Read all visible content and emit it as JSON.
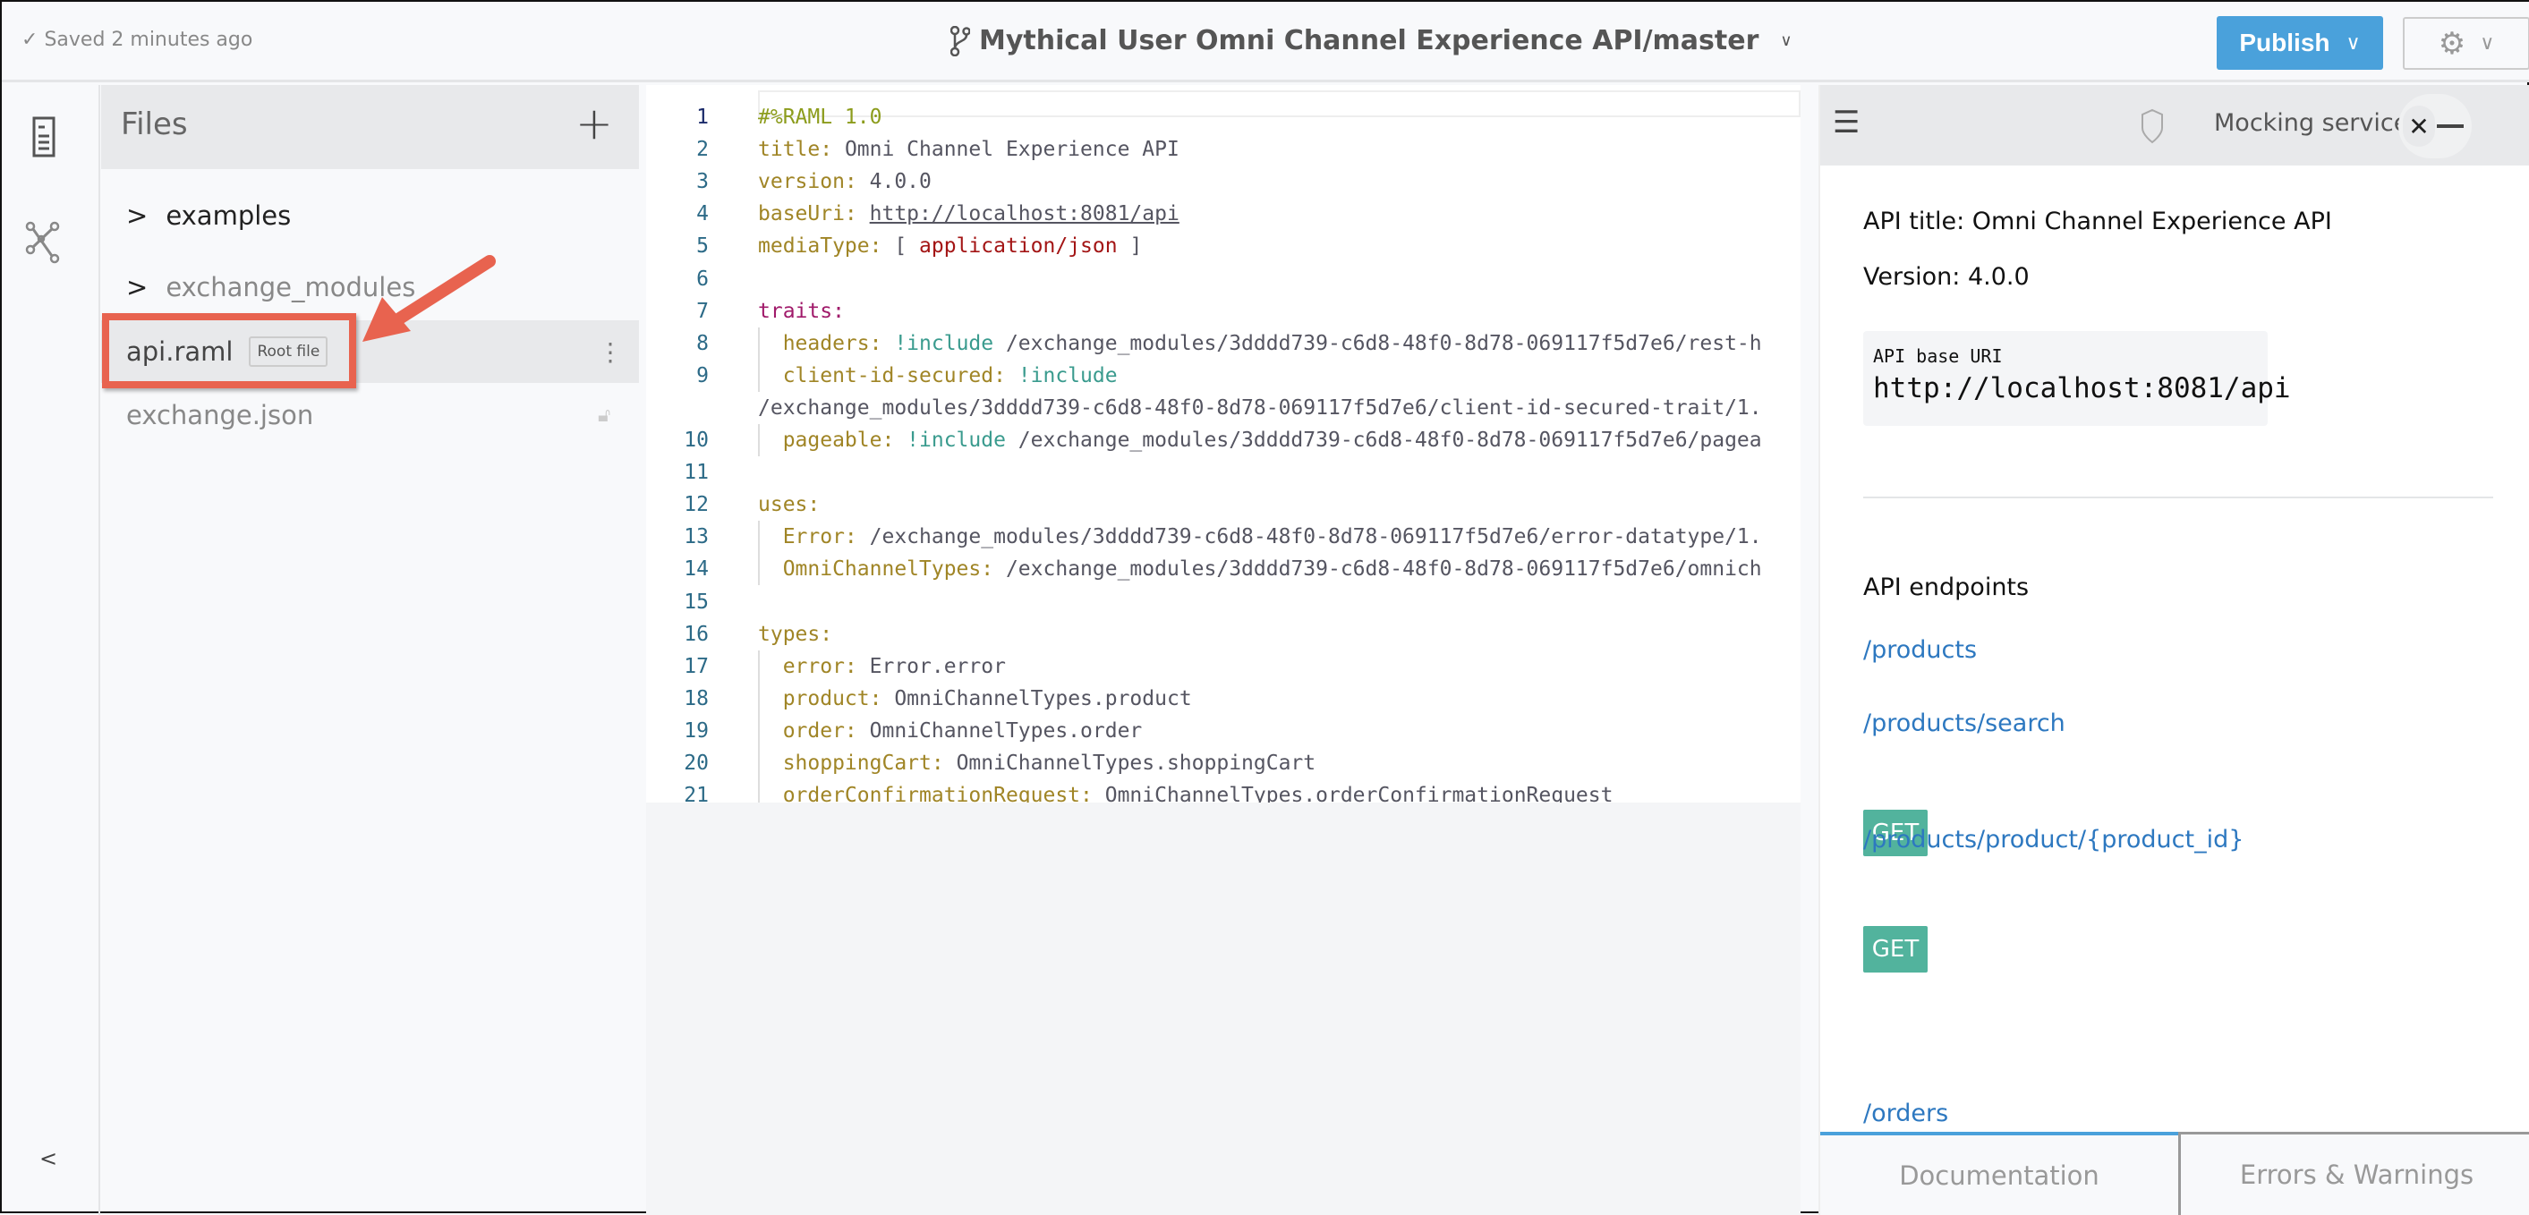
{
  "header": {
    "saved": "Saved 2 minutes ago",
    "project_title": "Mythical User Omni Channel Experience API/master",
    "publish_label": "Publish"
  },
  "files": {
    "title": "Files",
    "items": [
      {
        "name": "examples",
        "type": "folder"
      },
      {
        "name": "exchange_modules",
        "type": "folder"
      },
      {
        "name": "api.raml",
        "badge": "Root file",
        "selected": true
      },
      {
        "name": "exchange.json",
        "locked": true
      }
    ]
  },
  "editor": {
    "lines": [
      {
        "n": "1",
        "seg": [
          [
            "h",
            "#%RAML 1.0"
          ]
        ]
      },
      {
        "n": "2",
        "seg": [
          [
            "k",
            "title: "
          ],
          [
            "s",
            "Omni Channel Experience API"
          ]
        ]
      },
      {
        "n": "3",
        "seg": [
          [
            "k",
            "version: "
          ],
          [
            "s",
            "4.0.0"
          ]
        ]
      },
      {
        "n": "4",
        "seg": [
          [
            "k",
            "baseUri: "
          ],
          [
            "s u",
            "http://localhost:8081/api"
          ]
        ]
      },
      {
        "n": "5",
        "seg": [
          [
            "k",
            "mediaType: "
          ],
          [
            "s",
            "[ "
          ],
          [
            "r",
            "application/json"
          ],
          [
            "s",
            " ]"
          ]
        ]
      },
      {
        "n": "6",
        "seg": []
      },
      {
        "n": "7",
        "seg": [
          [
            "t",
            "traits:"
          ]
        ]
      },
      {
        "n": "8",
        "seg": [
          [
            "k",
            "  headers: "
          ],
          [
            "i",
            "!include "
          ],
          [
            "s",
            "/exchange_modules/3dddd739-c6d8-48f0-8d78-069117f5d7e6/rest-h"
          ]
        ]
      },
      {
        "n": "9",
        "seg": [
          [
            "k",
            "  client-id-secured: "
          ],
          [
            "i",
            "!include"
          ]
        ]
      },
      {
        "n": "",
        "seg": [
          [
            "s",
            "/exchange_modules/3dddd739-c6d8-48f0-8d78-069117f5d7e6/client-id-secured-trait/1."
          ]
        ]
      },
      {
        "n": "10",
        "seg": [
          [
            "k",
            "  pageable: "
          ],
          [
            "i",
            "!include "
          ],
          [
            "s",
            "/exchange_modules/3dddd739-c6d8-48f0-8d78-069117f5d7e6/pagea"
          ]
        ]
      },
      {
        "n": "11",
        "seg": []
      },
      {
        "n": "12",
        "seg": [
          [
            "k",
            "uses:"
          ]
        ]
      },
      {
        "n": "13",
        "seg": [
          [
            "k",
            "  Error: "
          ],
          [
            "s",
            "/exchange_modules/3dddd739-c6d8-48f0-8d78-069117f5d7e6/error-datatype/1."
          ]
        ]
      },
      {
        "n": "14",
        "seg": [
          [
            "k",
            "  OmniChannelTypes: "
          ],
          [
            "s",
            "/exchange_modules/3dddd739-c6d8-48f0-8d78-069117f5d7e6/omnich"
          ]
        ]
      },
      {
        "n": "15",
        "seg": []
      },
      {
        "n": "16",
        "seg": [
          [
            "k",
            "types:"
          ]
        ]
      },
      {
        "n": "17",
        "seg": [
          [
            "k",
            "  error: "
          ],
          [
            "s",
            "Error.error"
          ]
        ]
      },
      {
        "n": "18",
        "seg": [
          [
            "k",
            "  product: "
          ],
          [
            "s",
            "OmniChannelTypes.product"
          ]
        ]
      },
      {
        "n": "19",
        "seg": [
          [
            "k",
            "  order: "
          ],
          [
            "s",
            "OmniChannelTypes.order"
          ]
        ]
      },
      {
        "n": "20",
        "seg": [
          [
            "k",
            "  shoppingCart: "
          ],
          [
            "s",
            "OmniChannelTypes.shoppingCart"
          ]
        ]
      },
      {
        "n": "21",
        "seg": [
          [
            "k",
            "  orderConfirmationRequest: "
          ],
          [
            "s",
            "OmniChannelTypes.orderConfirmationRequest"
          ]
        ]
      },
      {
        "n": "22",
        "seg": [
          [
            "k",
            "  orderConfirmation: "
          ],
          [
            "s",
            "OmniChannelTypes.orderConfirmation"
          ]
        ]
      }
    ]
  },
  "panel": {
    "mocking_label": "Mocking service",
    "api_title": "API title: Omni Channel Experience API",
    "version": "Version: 4.0.0",
    "base_uri_label": "API base URI",
    "base_uri": "http://localhost:8081/api",
    "endpoints_title": "API endpoints",
    "endpoints": [
      {
        "path": "/products"
      },
      {
        "path": "/products/search",
        "method": "GET"
      },
      {
        "path": "/products/product/{product_id}",
        "method": "GET"
      },
      {
        "path": "/orders"
      }
    ],
    "tabs": [
      {
        "label": "Documentation",
        "active": true
      },
      {
        "label": "Errors & Warnings"
      }
    ]
  },
  "colors": {
    "accent": "#4aa1db",
    "get_badge": "#52b39d",
    "annotation": "#e8634f",
    "link": "#2d78c0"
  }
}
